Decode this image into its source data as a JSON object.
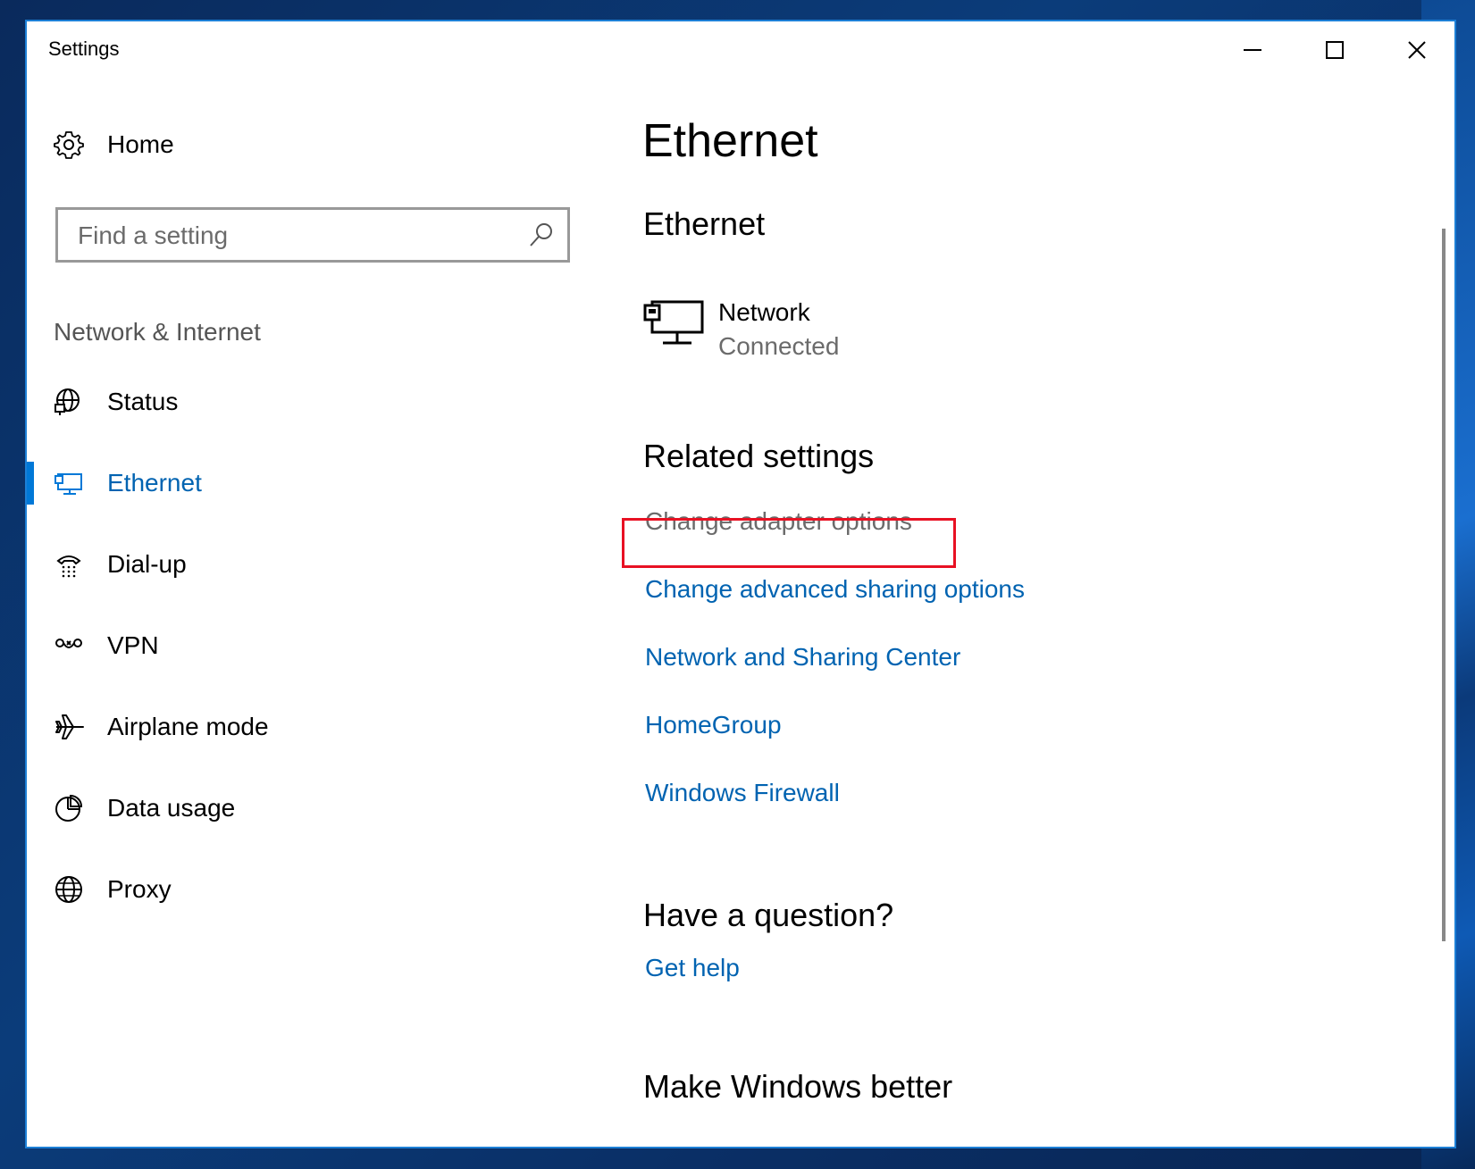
{
  "window": {
    "title": "Settings"
  },
  "sidebar": {
    "home_label": "Home",
    "search": {
      "placeholder": "Find a setting"
    },
    "section": "Network & Internet",
    "items": [
      {
        "label": "Status",
        "icon": "globe-network-icon"
      },
      {
        "label": "Ethernet",
        "icon": "ethernet-icon",
        "active": true
      },
      {
        "label": "Dial-up",
        "icon": "dialup-phone-icon"
      },
      {
        "label": "VPN",
        "icon": "vpn-icon"
      },
      {
        "label": "Airplane mode",
        "icon": "airplane-icon"
      },
      {
        "label": "Data usage",
        "icon": "pie-chart-icon"
      },
      {
        "label": "Proxy",
        "icon": "globe-icon"
      }
    ]
  },
  "main": {
    "title": "Ethernet",
    "section_title": "Ethernet",
    "device": {
      "name": "Network",
      "status": "Connected"
    },
    "related": {
      "title": "Related settings",
      "links": [
        "Change adapter options",
        "Change advanced sharing options",
        "Network and Sharing Center",
        "HomeGroup",
        "Windows Firewall"
      ]
    },
    "question": {
      "title": "Have a question?",
      "link": "Get help"
    },
    "better": {
      "title": "Make Windows better"
    }
  },
  "colors": {
    "accent": "#0078d7",
    "link": "#0063b1",
    "highlight": "#e81123"
  }
}
